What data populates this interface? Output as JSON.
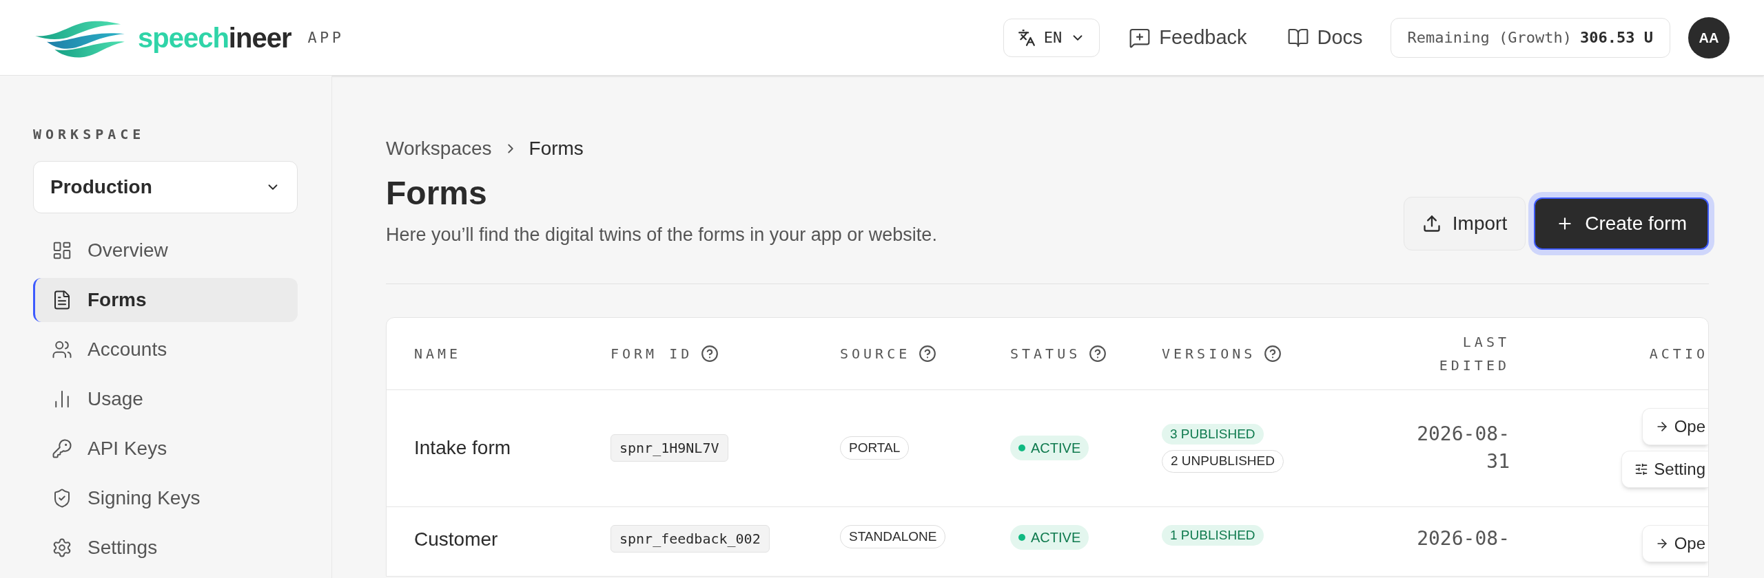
{
  "header": {
    "logo": {
      "accent": "speech",
      "rest": "ineer",
      "badge": "APP"
    },
    "language": "EN",
    "links": [
      {
        "label": "Feedback",
        "kind": "feedback"
      },
      {
        "label": "Docs",
        "kind": "docs"
      }
    ],
    "remaining": {
      "label": "Remaining (Growth)",
      "value": "306.53 U"
    },
    "avatar": "AA"
  },
  "sidebar": {
    "section_label": "WORKSPACE",
    "workspace": "Production",
    "items": [
      {
        "label": "Overview",
        "kind": "overview",
        "selected": false
      },
      {
        "label": "Forms",
        "kind": "forms",
        "selected": true
      },
      {
        "label": "Accounts",
        "kind": "accounts",
        "selected": false
      },
      {
        "label": "Usage",
        "kind": "usage",
        "selected": false
      },
      {
        "label": "API Keys",
        "kind": "api_keys",
        "selected": false
      },
      {
        "label": "Signing Keys",
        "kind": "signing_keys",
        "selected": false
      },
      {
        "label": "Settings",
        "kind": "settings",
        "selected": false
      }
    ]
  },
  "breadcrumb": [
    "Workspaces",
    "Forms"
  ],
  "page": {
    "title": "Forms",
    "subtitle": "Here you’ll find the digital twins of the forms in your app or website.",
    "buttons": [
      {
        "label": "Import",
        "kind": "import"
      },
      {
        "label": "Create form",
        "kind": "create"
      }
    ]
  },
  "table": {
    "columns": [
      {
        "label": "NAME",
        "kind": "plain"
      },
      {
        "label": "FORM ID",
        "kind": "help"
      },
      {
        "label": "SOURCE",
        "kind": "help"
      },
      {
        "label": "STATUS",
        "kind": "help"
      },
      {
        "label": "VERSIONS",
        "kind": "help"
      },
      {
        "label": "LAST EDITED",
        "kind": "plain"
      },
      {
        "label": "ACTIO",
        "kind": "plain"
      }
    ],
    "rows": [
      {
        "name": "Intake form",
        "form_id": "spnr_1H9NL7V",
        "source": "PORTAL",
        "status": {
          "label": "ACTIVE",
          "kind": "active"
        },
        "versions": [
          {
            "label": "3 PUBLISHED",
            "kind": "published"
          },
          {
            "label": "2 UNPUBLISHED",
            "kind": "unpublished"
          }
        ],
        "last_edited": "2026-08-31",
        "actions": [
          {
            "label": "Ope",
            "kind": "open"
          },
          {
            "label": "Setting",
            "kind": "settings"
          }
        ]
      },
      {
        "name": "Customer",
        "form_id": "spnr_feedback_002",
        "source": "STANDALONE",
        "status": {
          "label": "ACTIVE",
          "kind": "active"
        },
        "versions": [
          {
            "label": "1 PUBLISHED",
            "kind": "published"
          }
        ],
        "last_edited": "2026-08-",
        "actions": [
          {
            "label": "Ope",
            "kind": "open"
          }
        ]
      }
    ]
  }
}
